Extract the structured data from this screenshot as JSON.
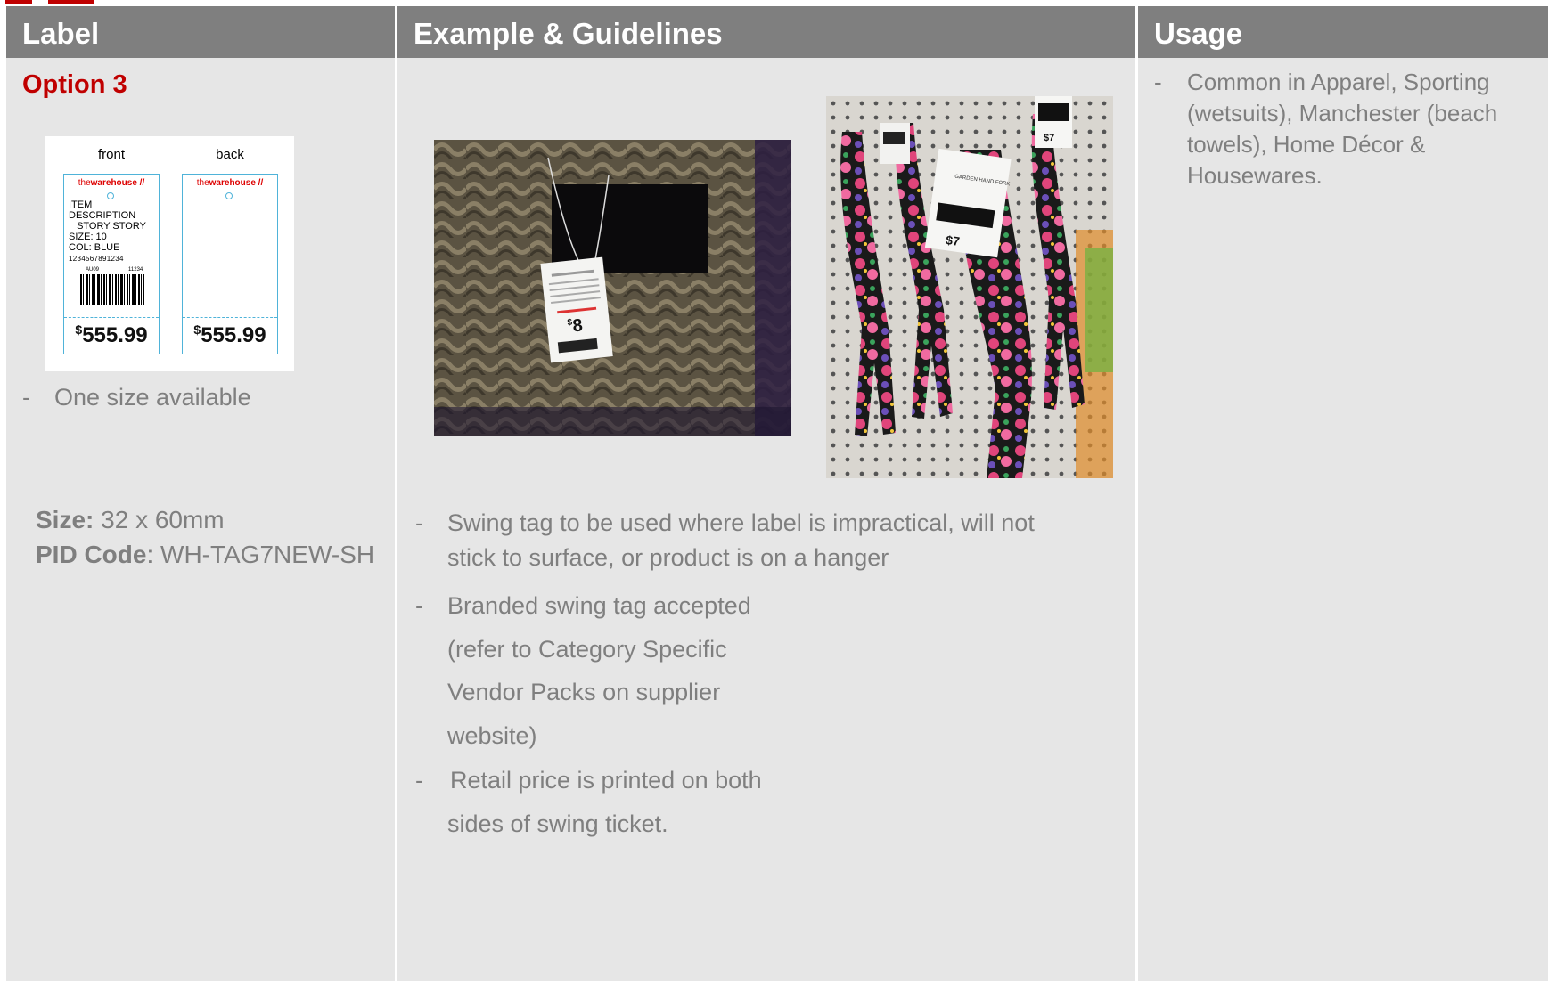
{
  "columns": {
    "label": {
      "header": "Label"
    },
    "example": {
      "header": "Example & Guidelines"
    },
    "usage": {
      "header": "Usage"
    }
  },
  "label_col": {
    "option_title": "Option 3",
    "tag": {
      "front_label": "front",
      "back_label": "back",
      "brand_the": "the",
      "brand_name": "warehouse",
      "desc_line1": "ITEM DESCRIPTION",
      "desc_line2": "STORY STORY",
      "size_line": "SIZE: 10",
      "col_line": "COL: BLUE",
      "sku": "1234567891234",
      "small_left": "AU09",
      "small_right": "11234",
      "price_symbol": "$",
      "price_value": "555.99"
    },
    "bullet_dash": "-",
    "bullet_text": "One size available",
    "size_label": "Size:",
    "size_value": " 32 x 60mm",
    "pid_label": "PID Code",
    "pid_value": ": WH-TAG7NEW-SH"
  },
  "example_col": {
    "guidelines": [
      {
        "dash": "-",
        "lines": [
          "Swing tag to be used where label is impractical, will not",
          "stick to surface, or product is on a hanger"
        ]
      },
      {
        "dash": "-",
        "lines": [
          "Branded swing tag accepted",
          "(refer to Category Specific",
          "Vendor Packs on supplier",
          "website)"
        ]
      },
      {
        "dash": "-",
        "lines": [
          "Retail price is printed on both",
          "sides of swing ticket."
        ]
      }
    ],
    "photo1": {
      "tag_price": "8",
      "tag_currency": "$"
    },
    "photo2": {
      "tag_price": "$7",
      "tag_text": "GARDEN HAND FORK",
      "top_price": "$7"
    }
  },
  "usage_col": {
    "dash": "-",
    "text": "Common in Apparel, Sporting (wetsuits), Manchester (beach towels), Home Décor & Housewares."
  },
  "colors": {
    "header_bg": "#7f7f7f",
    "body_bg": "#e6e6e6",
    "accent_red": "#c00000",
    "text_gray": "#7f7f7f",
    "tag_blue": "#4fb3d9"
  }
}
